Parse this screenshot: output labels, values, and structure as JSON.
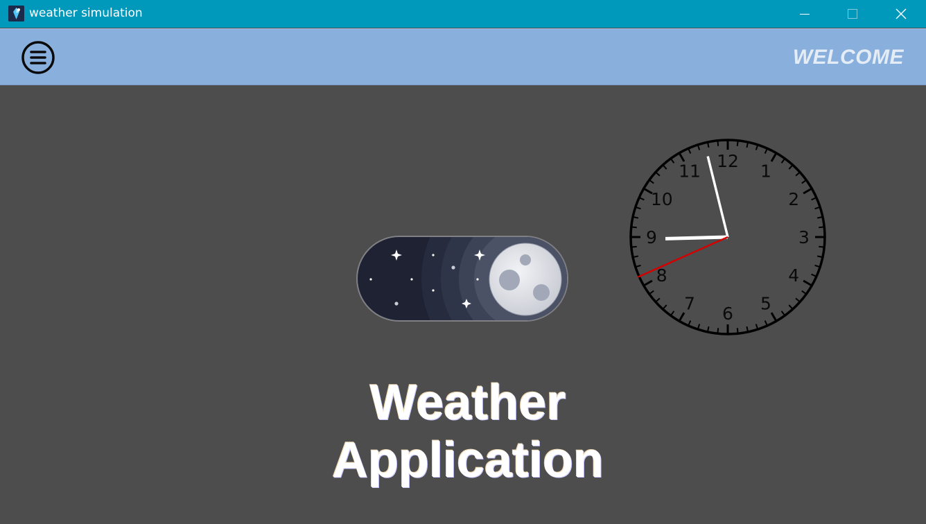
{
  "window": {
    "title": "weather simulation",
    "controls": [
      "minimize-icon",
      "maximize-icon",
      "close-icon"
    ]
  },
  "header": {
    "menu_icon": "hamburger-menu-icon",
    "welcome_text": "WELCOME"
  },
  "theme_toggle": {
    "state": "night",
    "icon": "moon-icon"
  },
  "clock": {
    "numerals": [
      "12",
      "1",
      "2",
      "3",
      "4",
      "5",
      "6",
      "7",
      "8",
      "9",
      "10",
      "11"
    ],
    "time": {
      "hour": 8,
      "minute": 57,
      "second": 41
    }
  },
  "main": {
    "title_line1": "Weather",
    "title_line2": "Application"
  },
  "colors": {
    "title_bar": "#0099bc",
    "header_bar": "#89b0dc",
    "background": "#4d4d4d",
    "second_hand": "#d40000"
  }
}
